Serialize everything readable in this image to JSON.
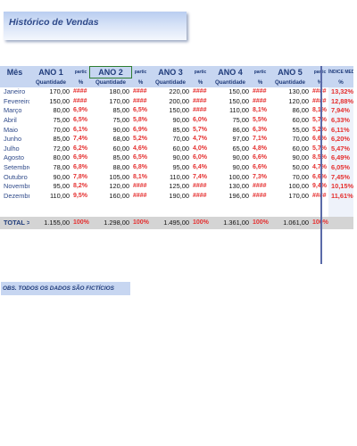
{
  "title": "Histórico de Vendas",
  "headers": {
    "mes": "Mês",
    "anos": [
      "ANO 1",
      "ANO 2",
      "ANO 3",
      "ANO 4",
      "ANO 5"
    ],
    "partic": "partic",
    "indice": "ÍNDICE MED",
    "quantidade": "Quantidade",
    "percent": "%"
  },
  "rows": [
    {
      "mes": "Janeiro",
      "q": [
        "170,00",
        "180,00",
        "220,00",
        "150,00",
        "130,00"
      ],
      "p": [
        "####",
        "####",
        "####",
        "####",
        "####"
      ],
      "indice": "13,32%"
    },
    {
      "mes": "Fevereiro",
      "q": [
        "150,00",
        "170,00",
        "200,00",
        "150,00",
        "120,00"
      ],
      "p": [
        "####",
        "####",
        "####",
        "####",
        "####"
      ],
      "indice": "12,88%"
    },
    {
      "mes": "Março",
      "q": [
        "80,00",
        "85,00",
        "150,00",
        "110,00",
        "86,00"
      ],
      "p": [
        "6,9%",
        "6,5%",
        "####",
        "8,1%",
        "8,1%"
      ],
      "indice": "7,94%"
    },
    {
      "mes": "Abril",
      "q": [
        "75,00",
        "75,00",
        "90,00",
        "75,00",
        "60,00"
      ],
      "p": [
        "6,5%",
        "5,8%",
        "6,0%",
        "5,5%",
        "5,7%"
      ],
      "indice": "6,33%"
    },
    {
      "mes": "Maio",
      "q": [
        "70,00",
        "90,00",
        "85,00",
        "86,00",
        "55,00"
      ],
      "p": [
        "6,1%",
        "6,9%",
        "5,7%",
        "6,3%",
        "5,2%"
      ],
      "indice": "6,11%"
    },
    {
      "mes": "Junho",
      "q": [
        "85,00",
        "68,00",
        "70,00",
        "97,00",
        "70,00"
      ],
      "p": [
        "7,4%",
        "5,2%",
        "4,7%",
        "7,1%",
        "6,6%"
      ],
      "indice": "6,20%"
    },
    {
      "mes": "Julho",
      "q": [
        "72,00",
        "60,00",
        "60,00",
        "65,00",
        "60,00"
      ],
      "p": [
        "6,2%",
        "4,6%",
        "4,0%",
        "4,8%",
        "5,7%"
      ],
      "indice": "5,47%"
    },
    {
      "mes": "Agosto",
      "q": [
        "80,00",
        "85,00",
        "90,00",
        "90,00",
        "90,00"
      ],
      "p": [
        "6,9%",
        "6,5%",
        "6,0%",
        "6,6%",
        "8,5%"
      ],
      "indice": "6,49%"
    },
    {
      "mes": "Setembro",
      "q": [
        "78,00",
        "88,00",
        "95,00",
        "90,00",
        "50,00"
      ],
      "p": [
        "6,8%",
        "6,8%",
        "6,4%",
        "6,6%",
        "4,7%"
      ],
      "indice": "6,05%"
    },
    {
      "mes": "Outubro",
      "q": [
        "90,00",
        "105,00",
        "110,00",
        "100,00",
        "70,00"
      ],
      "p": [
        "7,8%",
        "8,1%",
        "7,4%",
        "7,3%",
        "6,6%"
      ],
      "indice": "7,45%"
    },
    {
      "mes": "Novembro",
      "q": [
        "95,00",
        "120,00",
        "125,00",
        "130,00",
        "100,00"
      ],
      "p": [
        "8,2%",
        "####",
        "####",
        "####",
        "9,4%"
      ],
      "indice": "10,15%"
    },
    {
      "mes": "Dezembro",
      "q": [
        "110,00",
        "160,00",
        "190,00",
        "196,00",
        "170,00"
      ],
      "p": [
        "9,5%",
        "####",
        "####",
        "####",
        "####"
      ],
      "indice": "11,61%"
    }
  ],
  "total": {
    "label": "TOTAL >>",
    "q": [
      "1.155,00",
      "1.298,00",
      "1.495,00",
      "1.361,00",
      "1.061,00"
    ],
    "p": [
      "100%",
      "100%",
      "100%",
      "100%",
      "100%"
    ]
  },
  "obs": "OBS. TODOS OS DADOS SÃO FICTÍCIOS"
}
